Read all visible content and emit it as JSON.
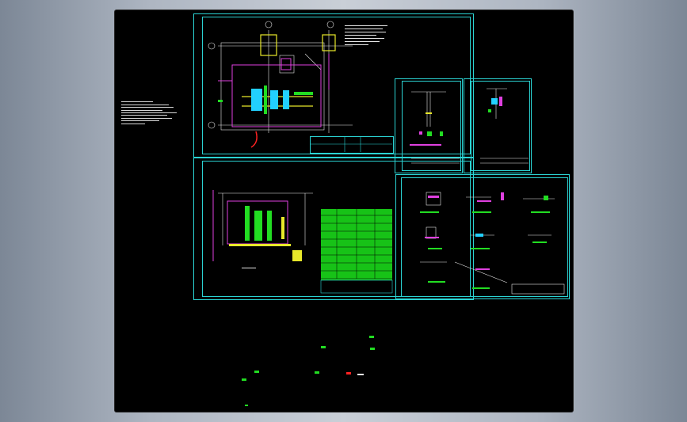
{
  "colors": {
    "background": "#000000",
    "frame": "#2bd3d3",
    "line": "#e6e6e6",
    "magenta": "#e040e0",
    "green": "#22dd22",
    "yellow": "#e8e82a",
    "red": "#ff2222",
    "cyan": "#22d0ff"
  },
  "grid_labels": {
    "col_a": "①",
    "col_b": "②",
    "row_a": "⑧",
    "row_b": "⑩"
  },
  "icons": [
    "viewport-canvas",
    "drawing-sheet",
    "title-block",
    "note-block"
  ]
}
